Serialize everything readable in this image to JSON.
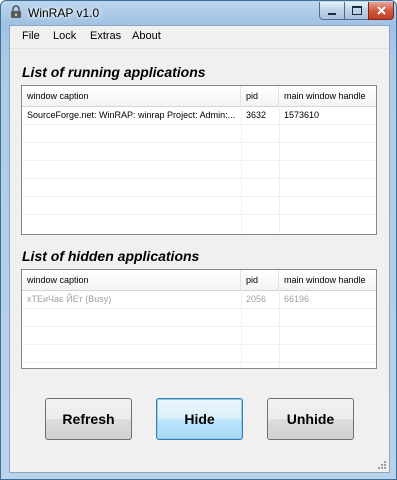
{
  "window": {
    "title": "WinRAP v1.0"
  },
  "menu": {
    "items": [
      "File",
      "Lock",
      "Extras",
      "About"
    ]
  },
  "running": {
    "heading": "List of running applications",
    "columns": [
      "window caption",
      "pid",
      "main window handle"
    ],
    "rows": [
      {
        "caption": "SourceForge.net: WinRAP: winrap Project: Admin:...",
        "pid": "3632",
        "handle": "1573610"
      }
    ]
  },
  "hidden": {
    "heading": "List of hidden applications",
    "columns": [
      "window caption",
      "pid",
      "main window handle"
    ],
    "rows": [
      {
        "caption": "хТЕиЧає ЙЕт (Busy)",
        "pid": "2056",
        "handle": "66196"
      }
    ]
  },
  "buttons": {
    "refresh": "Refresh",
    "hide": "Hide",
    "unhide": "Unhide"
  },
  "colors": {
    "row_text_disabled": "#a0a0a0",
    "titlebar": "#9fc1e2",
    "close_button": "#c23a22"
  }
}
